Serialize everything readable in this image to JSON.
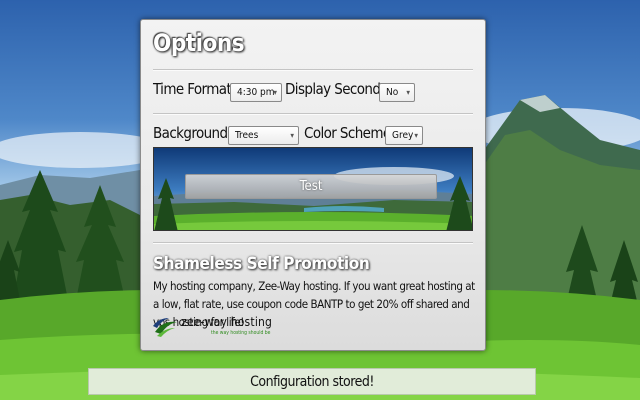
{
  "options": {
    "title": "Options",
    "time_format_label": "Time Format:",
    "time_format_value": "4:30 pm",
    "display_seconds_label": "Display Seconds:",
    "display_seconds_value": "No",
    "background_label": "Background:",
    "background_value": "Trees",
    "color_scheme_label": "Color Scheme:",
    "color_scheme_value": "Grey",
    "test_button_label": "Test"
  },
  "promotion": {
    "title": "Shameless Self Promotion",
    "text": "My hosting company, Zee-Way hosting. If you want great hosting at a low, flat rate, use coupon code BANTP to get 20% off shared and vps hosting for life!",
    "logo_name": "zee-way hosting",
    "logo_tagline": "the way hosting should be"
  },
  "status": {
    "message": "Configuration stored!"
  },
  "colors": {
    "panel": "#e9e9e9",
    "status_bg": "#e1ecd9",
    "logo_green": "#2d8a1c"
  }
}
